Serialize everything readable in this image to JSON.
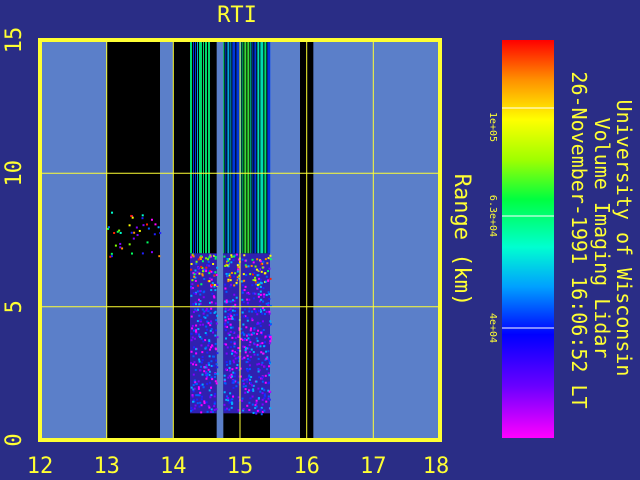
{
  "chart_data": {
    "type": "heatmap",
    "title": "RTI",
    "xlabel": "",
    "ylabel": "Range (km)",
    "xlim": [
      12,
      18
    ],
    "ylim": [
      0,
      15
    ],
    "xticks": [
      "12",
      "13",
      "14",
      "15",
      "16",
      "17",
      "18"
    ],
    "yticks": [
      "0",
      "5",
      "10",
      "15"
    ],
    "grid": true,
    "colorbar": {
      "ticks": [
        "1e+05",
        "6.3e+04",
        "4e+04"
      ],
      "tick_values": [
        100000,
        63000,
        40000
      ],
      "colormap": "rainbow"
    },
    "no_data_color": "#5b7fc9",
    "no_return_color": "#000000",
    "data_regions": [
      {
        "x": [
          13.0,
          13.8
        ],
        "state": "no-return",
        "speckle_range": [
          6.8,
          8.6
        ]
      },
      {
        "x": [
          14.0,
          14.25
        ],
        "state": "no-return"
      },
      {
        "x": [
          14.25,
          14.55
        ],
        "state": "measured",
        "range_max": 7.0,
        "streaks_above": true
      },
      {
        "x": [
          14.55,
          14.65
        ],
        "state": "measured",
        "range_max": 7.0
      },
      {
        "x": [
          14.75,
          15.45
        ],
        "state": "measured",
        "range_max": 7.0,
        "streaks_above": true
      },
      {
        "x": [
          15.9,
          16.1
        ],
        "state": "no-return"
      }
    ]
  },
  "side_text": {
    "line1": "University of Wisconsin",
    "line2": "Volume Imaging Lidar",
    "line3": "26-November-1991 16:06:52 LT"
  }
}
